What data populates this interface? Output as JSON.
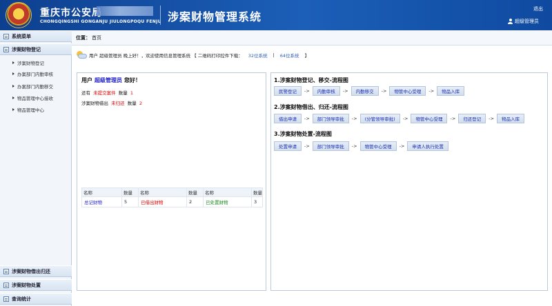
{
  "header": {
    "dept_name": "重庆市公安局",
    "dept_pinyin": "CHONGQINGSHI GONGANJU JIULONGPOQU FENJU",
    "system_title": "涉案财物管理系统",
    "logout_label": "退出",
    "user_label": "超级管理员"
  },
  "sidebar": {
    "sections": [
      {
        "label": "系统菜单"
      },
      {
        "label": "涉案财物登记"
      },
      {
        "label": "涉案财物借出归还"
      },
      {
        "label": "涉案财物处置"
      },
      {
        "label": "查询统计"
      }
    ],
    "items": [
      {
        "label": "涉案财物登记"
      },
      {
        "label": "办案部门内勤审核"
      },
      {
        "label": "办案部门内勤移交"
      },
      {
        "label": "物品管理中心接收"
      },
      {
        "label": "物品管理中心"
      }
    ]
  },
  "breadcrumb": {
    "prefix": "位置：",
    "current": "首页"
  },
  "welcome": {
    "text_user": "用户",
    "user": "超级管理员",
    "text_rest": "晚上好！，欢迎使用信息管理系统 【 二维码打印控件下载：",
    "link32": "32位系统",
    "sep": "|",
    "link64": "64位系统",
    "tail": "】"
  },
  "left_panel": {
    "greet_prefix": "用户",
    "greet_user": "超级管理员",
    "greet_suffix": "您好！",
    "line1_prefix": "还有",
    "line1_link": "未提交案件",
    "line1_mid": "数量",
    "line1_count": "1",
    "line2_prefix": "涉案财物借出",
    "line2_link": "未归还",
    "line2_mid": "数量",
    "line2_count": "2",
    "table": {
      "headers": [
        "名称",
        "数量",
        "名称",
        "数量",
        "名称",
        "数量"
      ],
      "row": [
        "总记财物",
        "5",
        "已借出财物",
        "2",
        "已处置财物",
        "3"
      ]
    }
  },
  "right_panel": {
    "flow1": {
      "title": "1.涉案财物登记、移交-流程图",
      "steps": [
        "民警登记",
        "内勤审核",
        "内勤移交",
        "物管中心受理",
        "物品入库"
      ]
    },
    "flow2": {
      "title": "2.涉案财物借出、归还-流程图",
      "steps": [
        "借出申请",
        "部门领导审批",
        "(分管领导审批)",
        "物管中心受理",
        "归还登记",
        "物品入库"
      ]
    },
    "flow3": {
      "title": "3.涉案财物处置-流程图",
      "steps": [
        "处置申请",
        "部门领导审批",
        "物管中心受理",
        "申请人执行处置"
      ]
    },
    "arrow": "->"
  }
}
